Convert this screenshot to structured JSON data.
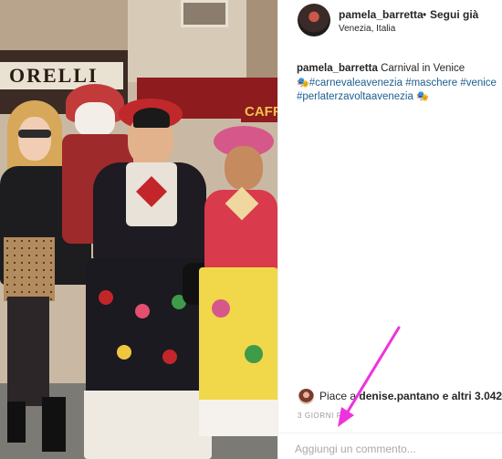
{
  "header": {
    "username": "pamela_barretta",
    "separator": "•",
    "follow_label": "Segui già",
    "location": "Venezia, Italia"
  },
  "caption": {
    "username": "pamela_barretta",
    "text": "Carnival in Venice",
    "emoji": "🎭",
    "hashtags": [
      "#carnevaleavenezia",
      "#maschere",
      "#venice",
      "#perlaterzavoltaavenezia"
    ]
  },
  "photo": {
    "sign_left": "ORELLI",
    "sign_right": "CAFFE",
    "description_colors": {
      "accent_red": "#c0282c",
      "arrow": "#ee33dd"
    }
  },
  "likes": {
    "prefix": "Piace a ",
    "user": "denise.pantano",
    "suffix": " e altri 3.042"
  },
  "timestamp": "3 GIORNI FA",
  "comment": {
    "placeholder": "Aggiungi un commento..."
  }
}
